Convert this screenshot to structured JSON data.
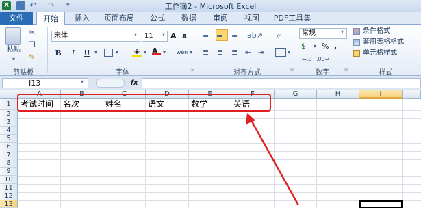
{
  "window": {
    "title": "工作簿2 - Microsoft Excel"
  },
  "tabs": [
    "文件",
    "开始",
    "插入",
    "页面布局",
    "公式",
    "数据",
    "审阅",
    "视图",
    "PDF工具集"
  ],
  "clipboard": {
    "paste_label": "粘贴",
    "group_label": "剪贴板"
  },
  "font": {
    "name": "宋体",
    "size": "11",
    "group_label": "字体",
    "bold": "B",
    "italic": "I",
    "underline": "U",
    "grow": "A",
    "shrink": "A",
    "color_letter": "A",
    "phonetic": "wén"
  },
  "alignment": {
    "group_label": "对齐方式"
  },
  "number": {
    "format": "常规",
    "percent": "%",
    "comma": ",",
    "group_label": "数字"
  },
  "styles": {
    "conditional": "条件格式",
    "table": "套用表格格式",
    "cell": "单元格样式",
    "group_label": "样式"
  },
  "formula_bar": {
    "name_box": "I13",
    "fx": "fx",
    "value": ""
  },
  "columns": [
    "A",
    "B",
    "C",
    "D",
    "E",
    "F",
    "G",
    "H",
    "I"
  ],
  "rows": [
    "1",
    "2",
    "3",
    "4",
    "5",
    "6",
    "7",
    "8",
    "9",
    "10",
    "11",
    "12",
    "13"
  ],
  "row1": [
    "考试时间",
    "名次",
    "姓名",
    "语文",
    "数学",
    "英语"
  ],
  "colors": {
    "file_tab": "#2a6db5",
    "annotation": "#e02020",
    "selected_col": "#f7d27a"
  }
}
